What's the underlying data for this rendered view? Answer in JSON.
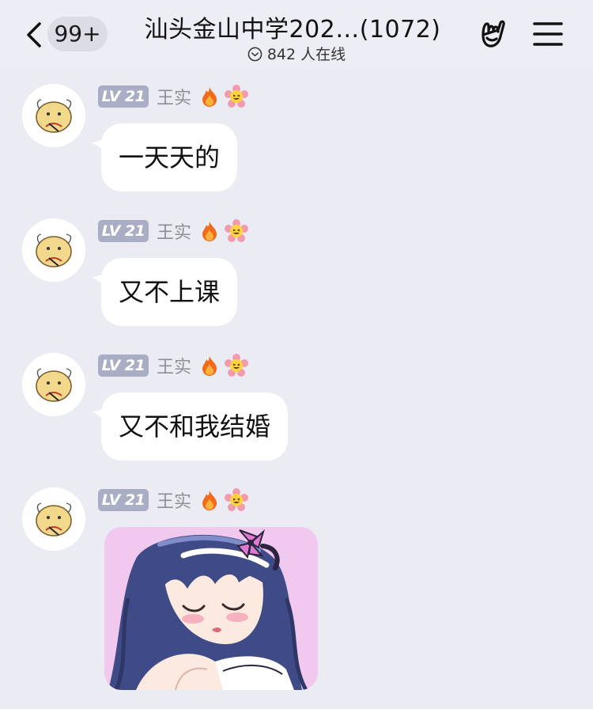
{
  "header": {
    "back_icon": "chevron-left-icon",
    "unread_count": "99+",
    "title": "汕头金山中学202…(1072)",
    "online_text": "842 人在线",
    "online_icon": "chevron-down-circle-icon",
    "hand_icon": "hand-icon",
    "menu_icon": "menu-icon"
  },
  "messages": [
    {
      "level": "LV 21",
      "sender": "王实",
      "text": "一天天的"
    },
    {
      "level": "LV 21",
      "sender": "王实",
      "text": "又不上课"
    },
    {
      "level": "LV 21",
      "sender": "王实",
      "text": "又不和我结婚"
    },
    {
      "level": "LV 21",
      "sender": "王实",
      "image": "anime-girl-sticker"
    }
  ],
  "colors": {
    "background": "#EBEBF3",
    "bubble": "#FFFFFF",
    "level_badge": "#A9AEC4",
    "sender_name": "#8E8E96"
  }
}
